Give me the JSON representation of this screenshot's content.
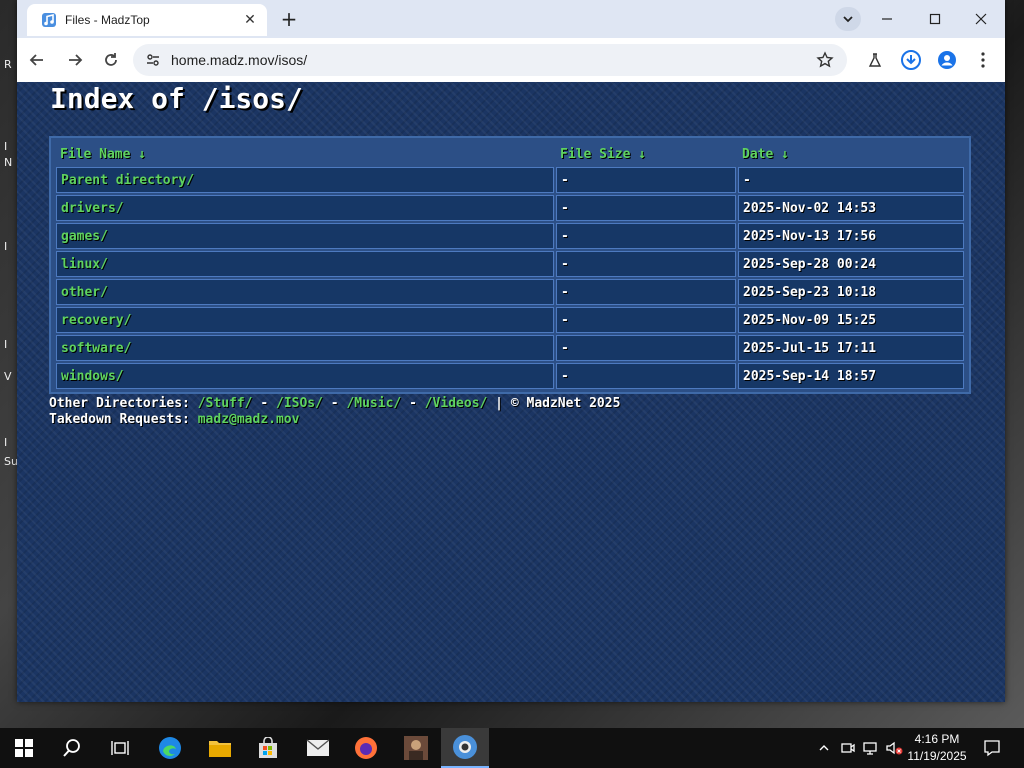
{
  "desktop": {
    "left_letters": [
      "R",
      "I",
      "N",
      "I",
      "I",
      "V",
      "I",
      "Su"
    ]
  },
  "browser": {
    "tab": {
      "title": "Files - MadzTop"
    },
    "url": "home.madz.mov/isos/"
  },
  "page": {
    "title": "Index of /isos/",
    "columns": [
      "File Name  ↓",
      "File Size  ↓",
      "Date  ↓"
    ],
    "rows": [
      {
        "name": "Parent directory/",
        "size": "-",
        "date": "-"
      },
      {
        "name": "drivers/",
        "size": "-",
        "date": "2025-Nov-02 14:53"
      },
      {
        "name": "games/",
        "size": "-",
        "date": "2025-Nov-13 17:56"
      },
      {
        "name": "linux/",
        "size": "-",
        "date": "2025-Sep-28 00:24"
      },
      {
        "name": "other/",
        "size": "-",
        "date": "2025-Sep-23 10:18"
      },
      {
        "name": "recovery/",
        "size": "-",
        "date": "2025-Nov-09 15:25"
      },
      {
        "name": "software/",
        "size": "-",
        "date": "2025-Jul-15 17:11"
      },
      {
        "name": "windows/",
        "size": "-",
        "date": "2025-Sep-14 18:57"
      }
    ],
    "footer": {
      "other_label": "Other Directories: ",
      "links": [
        "/Stuff/",
        "/ISOs/",
        "/Music/",
        "/Videos/"
      ],
      "sep": " - ",
      "copyright": " | © MadzNet 2025",
      "takedown_label": "Takedown Requests: ",
      "takedown_email": "madz@madz.mov"
    }
  },
  "taskbar": {
    "time": "4:16 PM",
    "date": "11/19/2025"
  },
  "colors": {
    "page_bg": "#1b3563",
    "link_green": "#5fd35f",
    "cell_bg": "#163766"
  }
}
